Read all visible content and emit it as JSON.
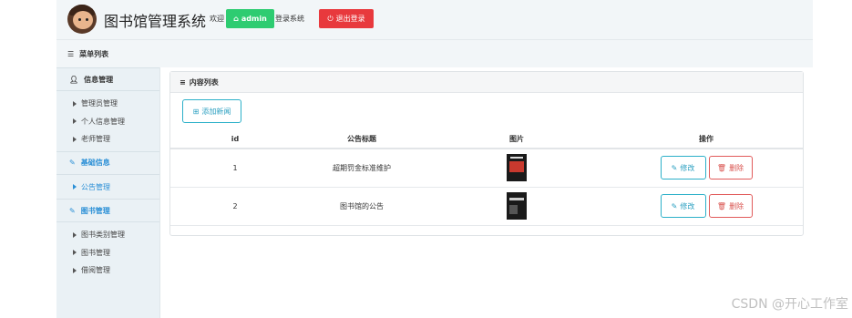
{
  "header": {
    "title": "图书馆管理系统",
    "welcome": "欢迎",
    "user": "admin",
    "login_system": "登录系统",
    "logout": "退出登录"
  },
  "menu": {
    "header": "菜单列表",
    "groups": [
      {
        "title": "信息管理",
        "icon": "user-icon",
        "items": [
          "管理员管理",
          "个人信息管理",
          "老师管理"
        ]
      },
      {
        "title": "基础信息",
        "icon": "edit-icon",
        "items": [
          "公告管理"
        ]
      },
      {
        "title": "图书管理",
        "icon": "edit-icon",
        "items": [
          "图书类别管理",
          "图书管理",
          "借阅管理"
        ]
      }
    ]
  },
  "content": {
    "panel_title": "内容列表",
    "add_button": "添加新闻",
    "columns": [
      "id",
      "公告标题",
      "图片",
      "操作"
    ],
    "rows": [
      {
        "id": "1",
        "title": "超期罚金标准维护"
      },
      {
        "id": "2",
        "title": "图书馆的公告"
      }
    ],
    "edit_label": "修改",
    "delete_label": "删除"
  },
  "colors": {
    "accent": "#2a8fd6",
    "success": "#2ecc71",
    "danger": "#e8393d",
    "info": "#2cb0c9"
  },
  "watermark": "CSDN @开心工作室"
}
